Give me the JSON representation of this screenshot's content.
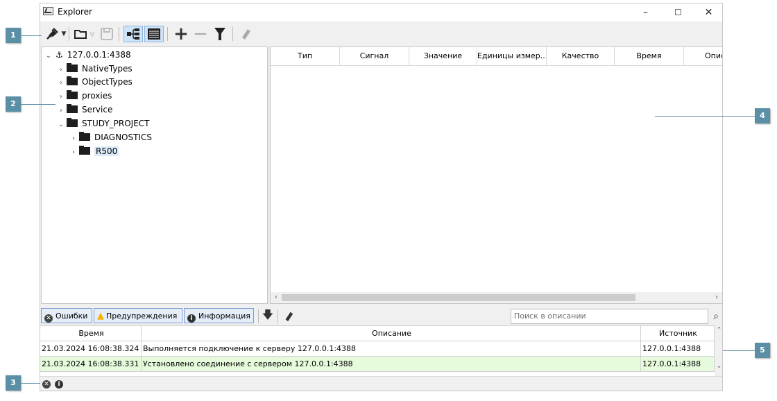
{
  "window": {
    "title": "Explorer",
    "minimize": "–",
    "maximize": "☐",
    "close": "✕"
  },
  "tree": {
    "root": "127.0.0.1:4388",
    "items": [
      {
        "label": "NativeTypes"
      },
      {
        "label": "ObjectTypes"
      },
      {
        "label": "proxies"
      },
      {
        "label": "Service"
      },
      {
        "label": "STUDY_PROJECT"
      },
      {
        "label": "DIAGNOSTICS"
      },
      {
        "label": "R500"
      }
    ]
  },
  "table": {
    "columns": [
      "Тип",
      "Сигнал",
      "Значение",
      "Единицы измер...",
      "Качество",
      "Время",
      "Описа"
    ]
  },
  "log": {
    "tabs": {
      "errors": "Ошибки",
      "warnings": "Предупреждения",
      "info": "Информация"
    },
    "search_placeholder": "Поиск в описании",
    "headers": {
      "time": "Время",
      "description": "Описание",
      "source": "Источник"
    },
    "rows": [
      {
        "time": "21.03.2024 16:08:38.324",
        "description": "Выполняется подключение к серверу 127.0.0.1:4388",
        "source": "127.0.0.1:4388",
        "color": "#ffffff"
      },
      {
        "time": "21.03.2024 16:08:38.331",
        "description": "Установлено соединение с сервером 127.0.0.1:4388",
        "source": "127.0.0.1:4388",
        "color": "#e6fbdc"
      }
    ]
  },
  "callouts": [
    "1",
    "2",
    "3",
    "4",
    "5"
  ],
  "colors": {
    "callout": "#5b8fa6",
    "error": "#444444",
    "warning": "#f5b400",
    "info": "#333333"
  }
}
